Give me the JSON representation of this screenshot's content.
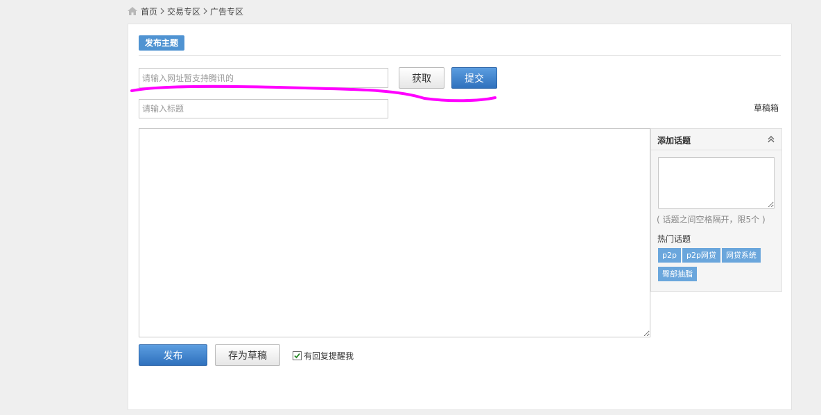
{
  "breadcrumb": {
    "items": [
      "首页",
      "交易专区",
      "广告专区"
    ]
  },
  "post": {
    "badge": "发布主题",
    "url_placeholder": "请输入网址暂支持腾讯的",
    "fetch_label": "获取",
    "submit_label": "提交",
    "title_placeholder": "请输入标题",
    "drafts_label": "草稿箱"
  },
  "topics": {
    "header": "添加话题",
    "hint": "( 话题之间空格隔开，限5个 )",
    "hot_label": "热门话题",
    "tags": [
      "p2p",
      "p2p网贷",
      "网贷系统",
      "臀部抽脂"
    ]
  },
  "actions": {
    "publish_label": "发布",
    "save_draft_label": "存为草稿",
    "notify_label": "有回复提醒我",
    "notify_checked": true
  },
  "colors": {
    "accent": "#4f93d2",
    "annotation": "#ff00ff"
  }
}
